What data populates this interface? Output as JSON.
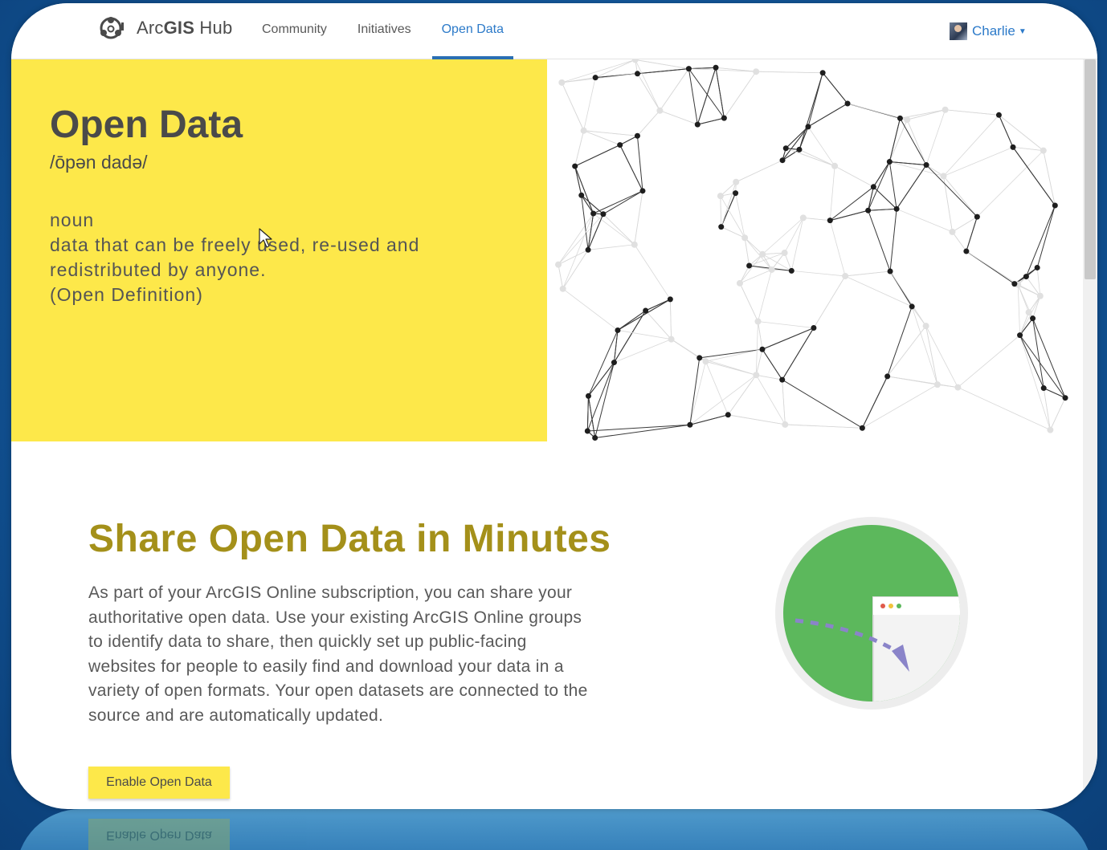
{
  "header": {
    "brand_prefix": "Arc",
    "brand_bold": "GIS",
    "brand_suffix": " Hub",
    "nav": [
      {
        "label": "Community",
        "active": false
      },
      {
        "label": "Initiatives",
        "active": false
      },
      {
        "label": "Open Data",
        "active": true
      }
    ],
    "user": {
      "name": "Charlie"
    }
  },
  "hero": {
    "title": "Open Data",
    "phonetic": "/ōpən dadə/",
    "definition_lines": [
      "noun",
      "data that can be freely used, re-used and",
      "redistributed by anyone.",
      "(Open Definition)"
    ]
  },
  "section": {
    "title": "Share Open Data in Minutes",
    "body_lines": [
      "As part of your ArcGIS Online subscription, you can share your",
      "authoritative open data. Use your existing ArcGIS Online groups",
      "to identify data to share, then quickly set up public-facing",
      "websites for people to easily find and download your data in a",
      "variety of open formats. Your open datasets are connected to the",
      "source and are automatically updated."
    ],
    "button_label": "Enable Open Data"
  },
  "reflection": {
    "button_label": "Enable Open Data"
  },
  "colors": {
    "hero_yellow": "#fde84a",
    "section_title": "#a4901a",
    "link_blue": "#2c7ac9",
    "nav_active_underline": "#2a6fb3",
    "chart_green": "#5cb85c",
    "arrow_purple": "#8a84c9"
  },
  "icons": {
    "logo": "arcgis-hub-logo-icon",
    "cursor": "mouse-cursor-icon",
    "caret": "caret-down-icon"
  }
}
